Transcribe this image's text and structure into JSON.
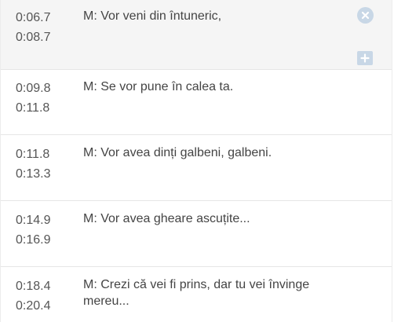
{
  "captions": [
    {
      "start": "0:06.7",
      "end": "0:08.7",
      "text": "M: Vor veni din întuneric,"
    },
    {
      "start": "0:09.8",
      "end": "0:11.8",
      "text": "M: Se vor pune în calea ta."
    },
    {
      "start": "0:11.8",
      "end": "0:13.3",
      "text": "M: Vor avea dinți galbeni, galbeni."
    },
    {
      "start": "0:14.9",
      "end": "0:16.9",
      "text": "M: Vor avea gheare ascuțite..."
    },
    {
      "start": "0:18.4",
      "end": "0:20.4",
      "text": "M: Crezi că vei fi prins, dar tu vei învinge mereu..."
    }
  ],
  "icons": {
    "remove": "close-circle-icon",
    "add": "plus-square-icon",
    "accent": "#c8d7e6"
  }
}
